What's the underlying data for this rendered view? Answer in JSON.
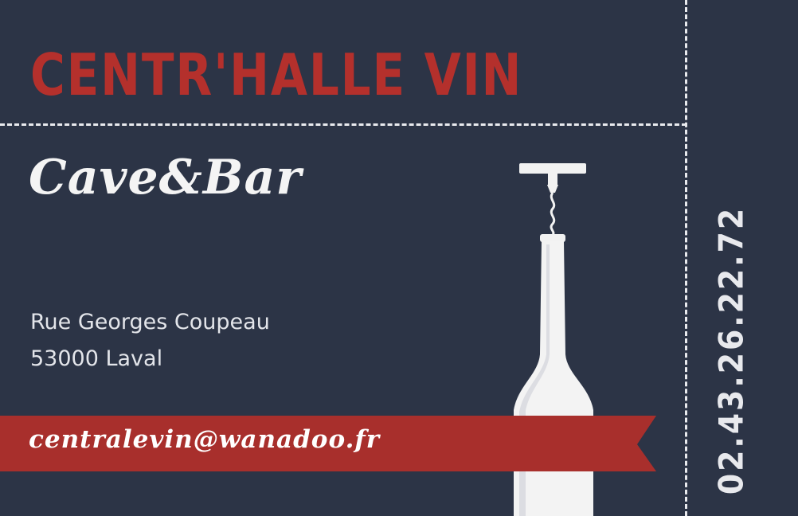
{
  "card": {
    "title": "CENTR'HALLE VIN",
    "subtitle": "Cave&Bar",
    "address_line1": "Rue Georges Coupeau",
    "address_line2": "53000 Laval",
    "email": "centralevin@wanadoo.fr",
    "phone": "02.43.26.22.72",
    "graphic": "wine-bottle-with-corkscrew-icon"
  },
  "colors": {
    "background": "#2c3446",
    "accent_red": "#b4302c",
    "ribbon_red": "#a82f2c",
    "text_light": "#f4f4f4",
    "dashes": "#e9eaee"
  }
}
